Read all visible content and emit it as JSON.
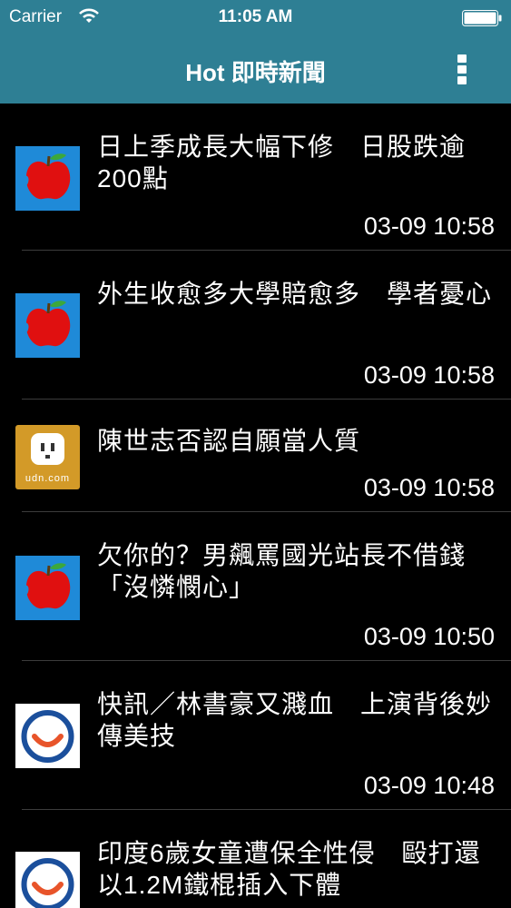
{
  "status_bar": {
    "carrier": "Carrier",
    "time": "11:05 AM"
  },
  "nav": {
    "title": "Hot 即時新聞"
  },
  "news": [
    {
      "headline": "日上季成長大幅下修　日股跌逾200點",
      "time": "03-09 10:58",
      "source_icon": "apple-news-icon"
    },
    {
      "headline": "外生收愈多大學賠愈多　學者憂心",
      "time": "03-09 10:58",
      "source_icon": "apple-news-icon"
    },
    {
      "headline": "陳世志否認自願當人質",
      "time": "03-09 10:58",
      "source_icon": "udn-icon"
    },
    {
      "headline": "欠你的？男飆罵國光站長不借錢「沒憐憫心」",
      "time": "03-09 10:50",
      "source_icon": "apple-news-icon"
    },
    {
      "headline": "快訊／林書豪又濺血　上演背後妙傳美技",
      "time": "03-09 10:48",
      "source_icon": "smile-logo-icon"
    },
    {
      "headline": "印度6歲女童遭保全性侵　毆打還以1.2M鐵棍插入下體",
      "time": "",
      "source_icon": "smile-logo-icon"
    }
  ],
  "udn_logo_text": "udn.com",
  "colors": {
    "header_bg": "#2e7f94",
    "list_bg": "#000000",
    "separator": "#3c3c3c",
    "apple_bg": "#1f8ad8",
    "udn_bg": "#d39a28",
    "smile_blue": "#1b4f9c",
    "smile_orange": "#e8542a"
  }
}
